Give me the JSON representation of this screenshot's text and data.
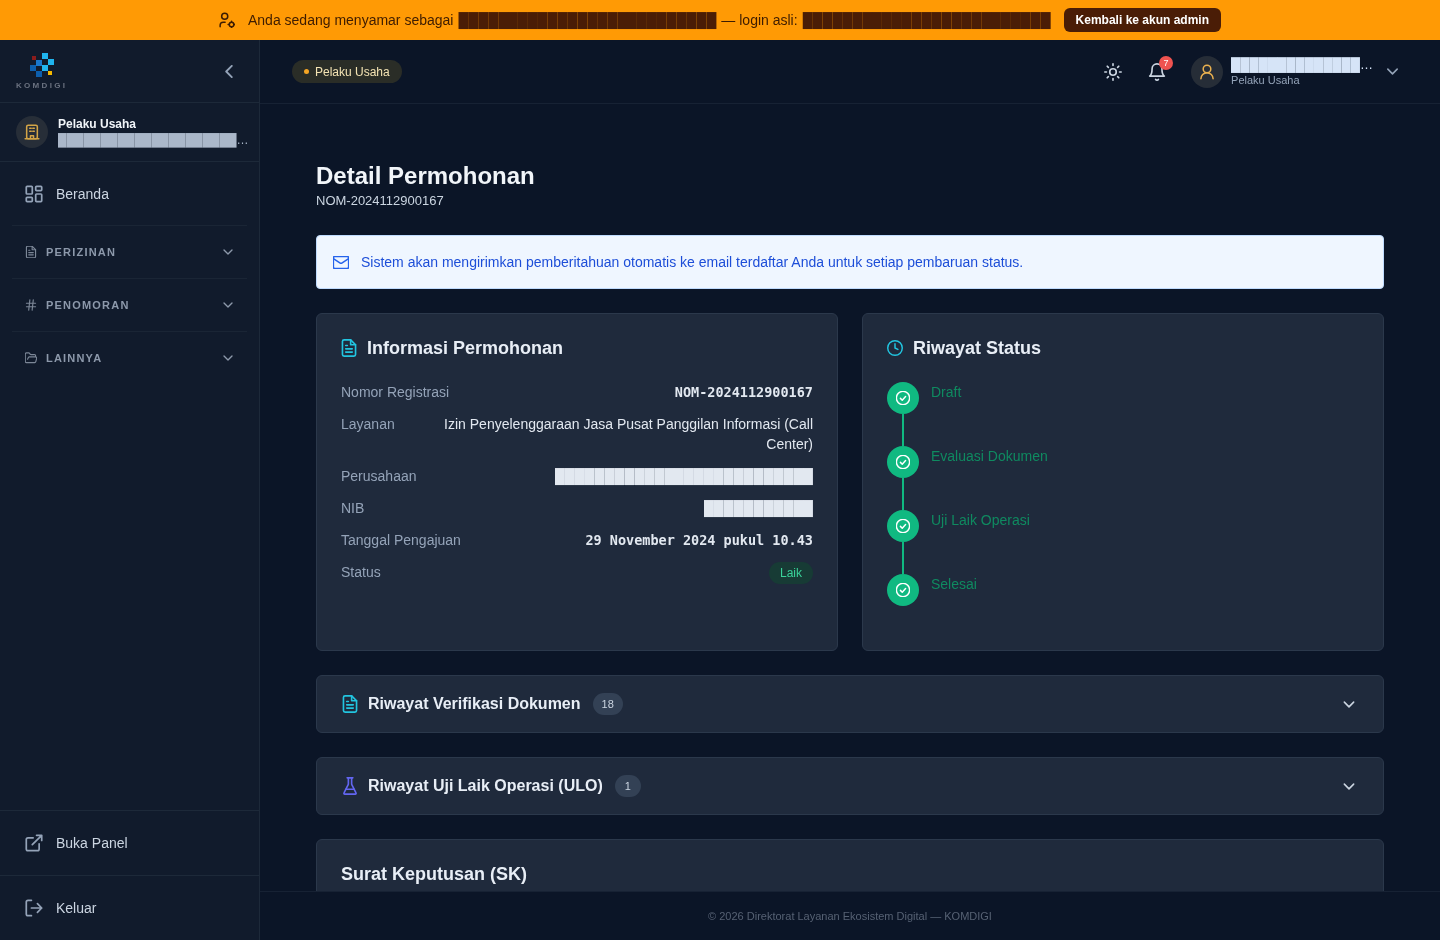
{
  "banner": {
    "prefix": "Anda sedang menyamar sebagai",
    "impersonated": "██████████████████████████",
    "separator": "— login asli:",
    "real_login": "█████████████████████████",
    "button": "Kembali ke akun admin"
  },
  "sidebar": {
    "logo_text": "KOMDIGI",
    "profile": {
      "role": "Pelaku Usaha",
      "name": "█████████████████████…"
    },
    "items": [
      {
        "kind": "link",
        "label": "Beranda"
      },
      {
        "kind": "group",
        "label": "PERIZINAN",
        "expanded": false
      },
      {
        "kind": "group",
        "label": "PENOMORAN",
        "expanded": false
      },
      {
        "kind": "group",
        "label": "LAINNYA",
        "expanded": false
      }
    ],
    "bottom_items": [
      {
        "label": "Buka Panel"
      },
      {
        "label": "Keluar"
      }
    ]
  },
  "header": {
    "role_badge": "Pelaku Usaha",
    "notifications": "7",
    "user": {
      "name": "██████████████…",
      "role": "Pelaku Usaha"
    }
  },
  "page": {
    "title": "Detail Permohonan",
    "subtitle": "NOM-2024112900167"
  },
  "alert": {
    "text": "Sistem akan mengirimkan pemberitahuan otomatis ke email terdaftar Anda untuk setiap pembaruan status."
  },
  "info_card": {
    "title": "Informasi Permohonan",
    "rows": [
      {
        "label": "Nomor Registrasi",
        "value": "NOM-2024112900167",
        "kind": "mono"
      },
      {
        "label": "Layanan",
        "value": "Izin Penyelenggaraan Jasa Pusat Panggilan Informasi (Call Center)",
        "kind": "text"
      },
      {
        "label": "Perusahaan",
        "value": "██████████████████████████",
        "kind": "text"
      },
      {
        "label": "NIB",
        "value": "███████████",
        "kind": "text"
      },
      {
        "label": "Tanggal Pengajuan",
        "value": "29 November 2024 pukul 10.43",
        "kind": "mono"
      },
      {
        "label": "Status",
        "value": "Laik",
        "kind": "badge"
      }
    ]
  },
  "status_card": {
    "title": "Riwayat Status",
    "steps": [
      {
        "label": "Draft",
        "completed": true
      },
      {
        "label": "Evaluasi Dokumen",
        "completed": true
      },
      {
        "label": "Uji Laik Operasi",
        "completed": true
      },
      {
        "label": "Selesai",
        "completed": true
      }
    ]
  },
  "sections": [
    {
      "title": "Riwayat Verifikasi Dokumen",
      "count": "18",
      "expanded": false
    },
    {
      "title": "Riwayat Uji Laik Operasi (ULO)",
      "count": "1",
      "expanded": false
    }
  ],
  "sk_card": {
    "title": "Surat Keputusan (SK)"
  },
  "footer": {
    "text": "© 2026 Direktorat Layanan Ekosistem Digital — KOMDIGI"
  }
}
